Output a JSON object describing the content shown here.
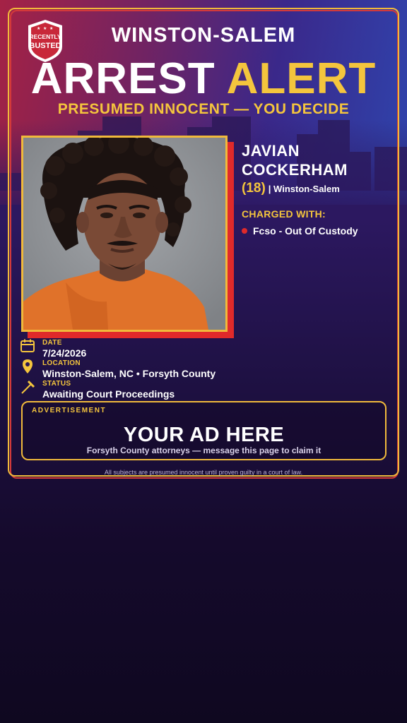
{
  "badge": {
    "line1": "RECENTLY",
    "line2": "BUSTED"
  },
  "header": {
    "city": "WINSTON-SALEM",
    "headline_word1": "ARREST",
    "headline_word2": "ALERT",
    "subhead": "PRESUMED INNOCENT — YOU DECIDE"
  },
  "subject": {
    "first_name": "JAVIAN",
    "last_name": "COCKERHAM",
    "age": "(18)",
    "location": "| Winston-Salem"
  },
  "charges": {
    "label": "CHARGED WITH:",
    "items": [
      "Fcso - Out Of Custody"
    ]
  },
  "details": {
    "date_label": "DATE",
    "date_value": "7/24/2026",
    "location_label": "LOCATION",
    "location_value": "Winston-Salem, NC • Forsyth County",
    "status_label": "STATUS",
    "status_value": "Awaiting Court Proceedings"
  },
  "ad": {
    "label": "ADVERTISEMENT",
    "title": "YOUR AD HERE",
    "subtitle": "Forsyth County attorneys — message this page to claim it"
  },
  "footer": {
    "disclaimer": "All subjects are presumed innocent until proven guilty in a court of law."
  },
  "colors": {
    "accent_gold": "#f4c53d",
    "accent_red": "#e02a2a",
    "background_dark": "#150a2c"
  }
}
